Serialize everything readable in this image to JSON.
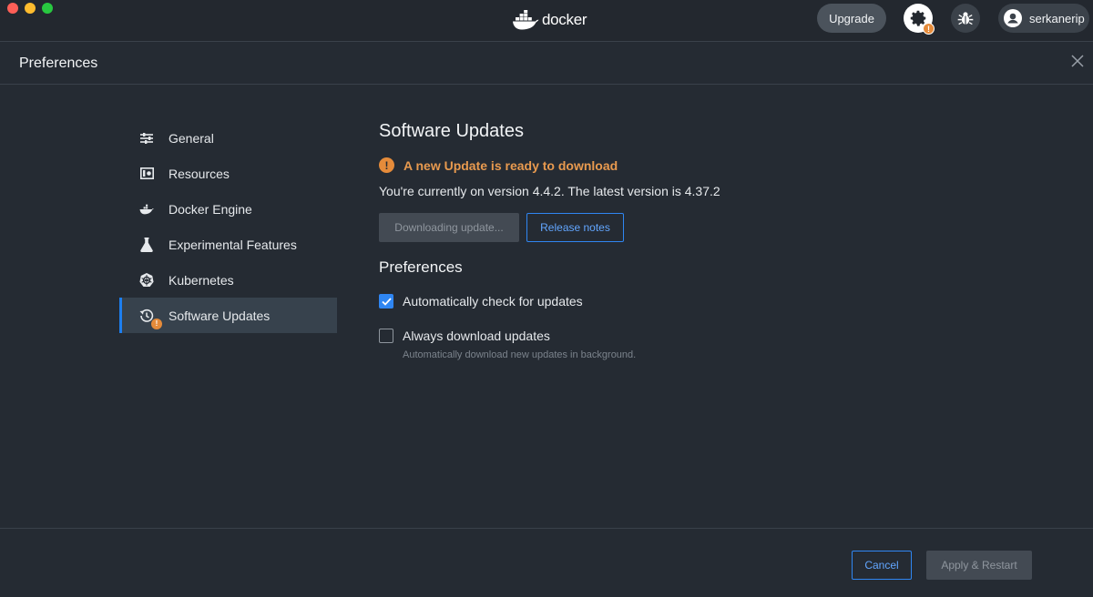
{
  "topbar": {
    "brand": "docker",
    "upgrade_label": "Upgrade",
    "settings_badge": "!",
    "user_name": "serkanerip"
  },
  "header": {
    "title": "Preferences"
  },
  "sidebar": {
    "items": [
      {
        "label": "General",
        "icon": "sliders-icon"
      },
      {
        "label": "Resources",
        "icon": "resources-icon"
      },
      {
        "label": "Docker Engine",
        "icon": "whale-icon"
      },
      {
        "label": "Experimental Features",
        "icon": "flask-icon"
      },
      {
        "label": "Kubernetes",
        "icon": "helm-wheel-icon"
      },
      {
        "label": "Software Updates",
        "icon": "history-icon",
        "active": true,
        "badge": "!"
      }
    ]
  },
  "main": {
    "title": "Software Updates",
    "alert": {
      "icon": "!",
      "text": "A new Update is ready to download"
    },
    "version_text": "You're currently on version 4.4.2. The latest version is 4.37.2",
    "download_button": "Downloading update...",
    "release_notes_button": "Release notes",
    "preferences_title": "Preferences",
    "options": [
      {
        "label": "Automatically check for updates",
        "checked": true
      },
      {
        "label": "Always download updates",
        "checked": false,
        "hint": "Automatically download new updates in background."
      }
    ]
  },
  "footer": {
    "cancel_label": "Cancel",
    "apply_label": "Apply & Restart"
  },
  "colors": {
    "background": "#252b33",
    "accent": "#2f86f2",
    "warning": "#e58b3a"
  }
}
